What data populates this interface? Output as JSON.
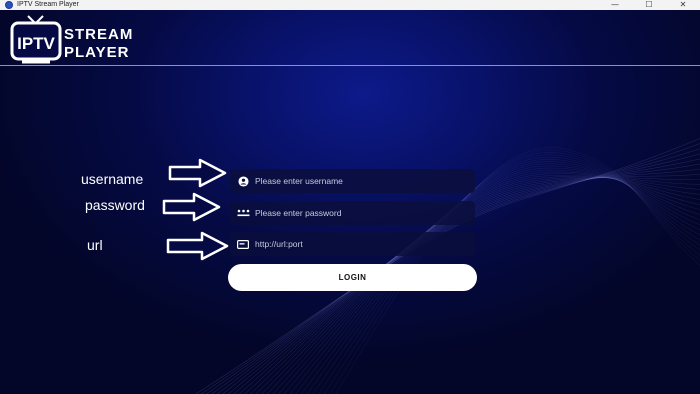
{
  "window": {
    "title": "IPTV Stream Player",
    "controls": {
      "minimize": "—",
      "maximize": "☐",
      "close": "✕"
    }
  },
  "logo": {
    "badge": "IPTV",
    "line1": "STREAM",
    "line2": "PLAYER"
  },
  "form": {
    "username": {
      "label": "username",
      "placeholder": "Please enter username",
      "icon": "user-icon"
    },
    "password": {
      "label": "password",
      "placeholder": "Please enter password",
      "icon": "password-dots-icon"
    },
    "url": {
      "label": "url",
      "placeholder": "http://url:port",
      "icon": "server-icon"
    },
    "login_label": "LOGIN"
  },
  "colors": {
    "background": "#050a45",
    "accent": "#0d1a8a",
    "button": "#ffffff"
  }
}
